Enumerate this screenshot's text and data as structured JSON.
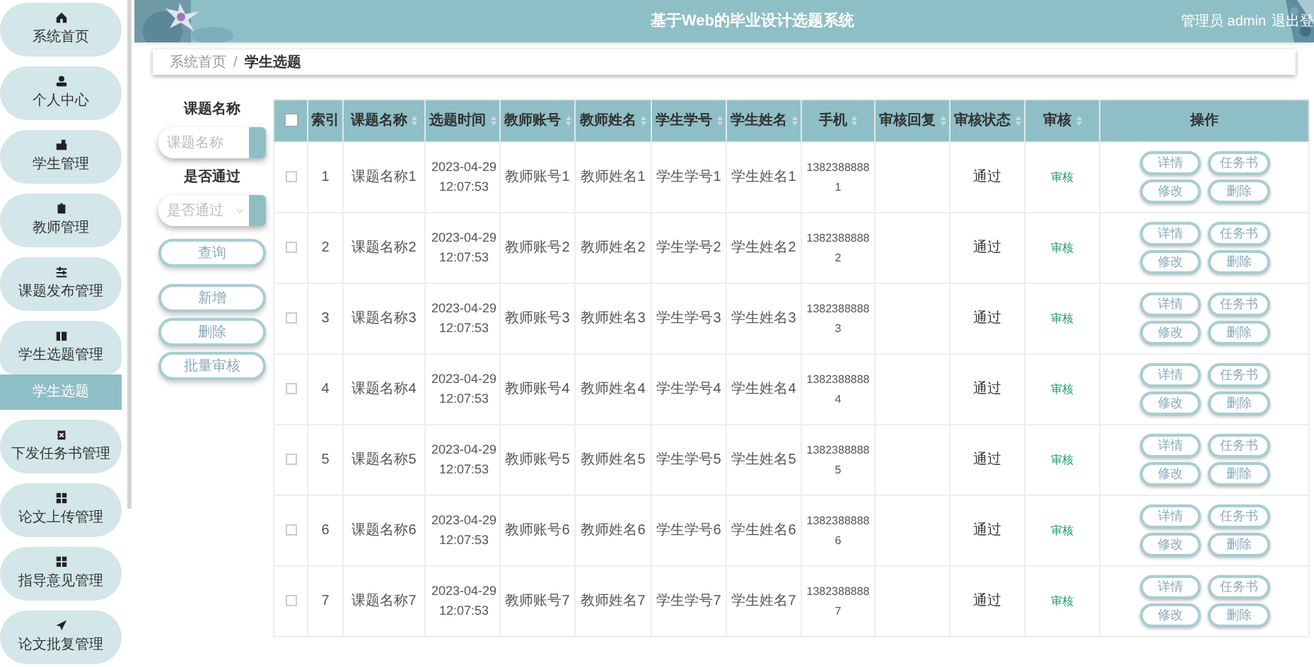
{
  "sidebar": {
    "items": [
      {
        "label": "系统首页",
        "expanded": false
      },
      {
        "label": "个人中心",
        "expanded": false
      },
      {
        "label": "学生管理",
        "expanded": false
      },
      {
        "label": "教师管理",
        "expanded": false
      },
      {
        "label": "课题发布管理",
        "expanded": false
      },
      {
        "label": "学生选题管理",
        "expanded": true,
        "children": [
          {
            "label": "学生选题",
            "selected": true
          }
        ]
      },
      {
        "label": "下发任务书管理",
        "expanded": false
      },
      {
        "label": "论文上传管理",
        "expanded": false
      },
      {
        "label": "指导意见管理",
        "expanded": false
      },
      {
        "label": "论文批复管理",
        "expanded": false
      }
    ]
  },
  "header": {
    "title": "基于Web的毕业设计选题系统",
    "user": "管理员 admin",
    "logout": "退出登"
  },
  "breadcrumb": {
    "separator": "/",
    "items": [
      "系统首页",
      "学生选题"
    ]
  },
  "filters": [
    {
      "label": "课题名称",
      "placeholder": "课题名称",
      "kind": "input"
    },
    {
      "label": "是否通过",
      "placeholder": "是否通过",
      "kind": "select"
    }
  ],
  "buttons": [
    {
      "label": "查询"
    },
    {
      "label": "新增"
    },
    {
      "label": "删除"
    },
    {
      "label": "批量审核"
    }
  ],
  "table": {
    "all_checked": false,
    "columns": [
      {
        "label": "索引",
        "sortable": false
      },
      {
        "label": "课题名称",
        "sortable": true
      },
      {
        "label": "选题时间",
        "sortable": true
      },
      {
        "label": "教师账号",
        "sortable": true
      },
      {
        "label": "教师姓名",
        "sortable": true
      },
      {
        "label": "学生学号",
        "sortable": true
      },
      {
        "label": "学生姓名",
        "sortable": true
      },
      {
        "label": "手机",
        "sortable": true
      },
      {
        "label": "审核回复",
        "sortable": true
      },
      {
        "label": "审核状态",
        "sortable": true
      },
      {
        "label": "审核",
        "sortable": true
      },
      {
        "label": "操作",
        "sortable": false
      }
    ],
    "rows": [
      {
        "checked": false,
        "cells": [
          "1",
          "课题名称1",
          "2023-04-29 12:07:53",
          "教师账号1",
          "教师姓名1",
          "学生学号1",
          "学生姓名1",
          "13823888881",
          "",
          "通过"
        ],
        "review_link": "审核",
        "actions": [
          "详情",
          "任务书",
          "修改",
          "删除"
        ]
      },
      {
        "checked": false,
        "cells": [
          "2",
          "课题名称2",
          "2023-04-29 12:07:53",
          "教师账号2",
          "教师姓名2",
          "学生学号2",
          "学生姓名2",
          "13823888882",
          "",
          "通过"
        ],
        "review_link": "审核",
        "actions": [
          "详情",
          "任务书",
          "修改",
          "删除"
        ]
      },
      {
        "checked": false,
        "cells": [
          "3",
          "课题名称3",
          "2023-04-29 12:07:53",
          "教师账号3",
          "教师姓名3",
          "学生学号3",
          "学生姓名3",
          "13823888883",
          "",
          "通过"
        ],
        "review_link": "审核",
        "actions": [
          "详情",
          "任务书",
          "修改",
          "删除"
        ]
      },
      {
        "checked": false,
        "cells": [
          "4",
          "课题名称4",
          "2023-04-29 12:07:53",
          "教师账号4",
          "教师姓名4",
          "学生学号4",
          "学生姓名4",
          "13823888884",
          "",
          "通过"
        ],
        "review_link": "审核",
        "actions": [
          "详情",
          "任务书",
          "修改",
          "删除"
        ]
      },
      {
        "checked": false,
        "cells": [
          "5",
          "课题名称5",
          "2023-04-29 12:07:53",
          "教师账号5",
          "教师姓名5",
          "学生学号5",
          "学生姓名5",
          "13823888885",
          "",
          "通过"
        ],
        "review_link": "审核",
        "actions": [
          "详情",
          "任务书",
          "修改",
          "删除"
        ]
      },
      {
        "checked": false,
        "cells": [
          "6",
          "课题名称6",
          "2023-04-29 12:07:53",
          "教师账号6",
          "教师姓名6",
          "学生学号6",
          "学生姓名6",
          "13823888886",
          "",
          "通过"
        ],
        "review_link": "审核",
        "actions": [
          "详情",
          "任务书",
          "修改",
          "删除"
        ]
      },
      {
        "checked": false,
        "cells": [
          "7",
          "课题名称7",
          "2023-04-29 12:07:53",
          "教师账号7",
          "教师姓名7",
          "学生学号7",
          "学生姓名7",
          "13823888887",
          "",
          "通过"
        ],
        "review_link": "审核",
        "actions": [
          "详情",
          "任务书",
          "修改",
          "删除"
        ]
      }
    ]
  }
}
